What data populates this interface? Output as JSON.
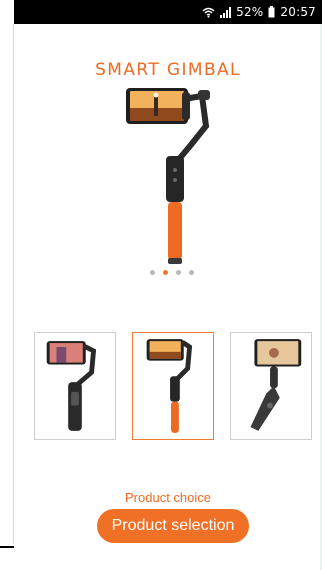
{
  "status_bar": {
    "text": "52% ▪ 20:57",
    "battery_label": "52%",
    "time": "20:57",
    "icons": [
      "wifi-icon",
      "signal-icon",
      "battery-icon"
    ]
  },
  "hero": {
    "title": "SMART GIMBAL",
    "image_name": "smart-gimbal-orange"
  },
  "carousel": {
    "pages": 4,
    "active_index": 1
  },
  "thumbnails": [
    {
      "name": "gimbal-black",
      "selected": false
    },
    {
      "name": "gimbal-orange",
      "selected": true
    },
    {
      "name": "gimbal-folding",
      "selected": false
    }
  ],
  "actions": {
    "choice_label": "Product choice",
    "button_label": "Product selection"
  },
  "colors": {
    "accent": "#f07026",
    "status_bar": "#000000",
    "thumb_border": "#cfcfcf"
  }
}
